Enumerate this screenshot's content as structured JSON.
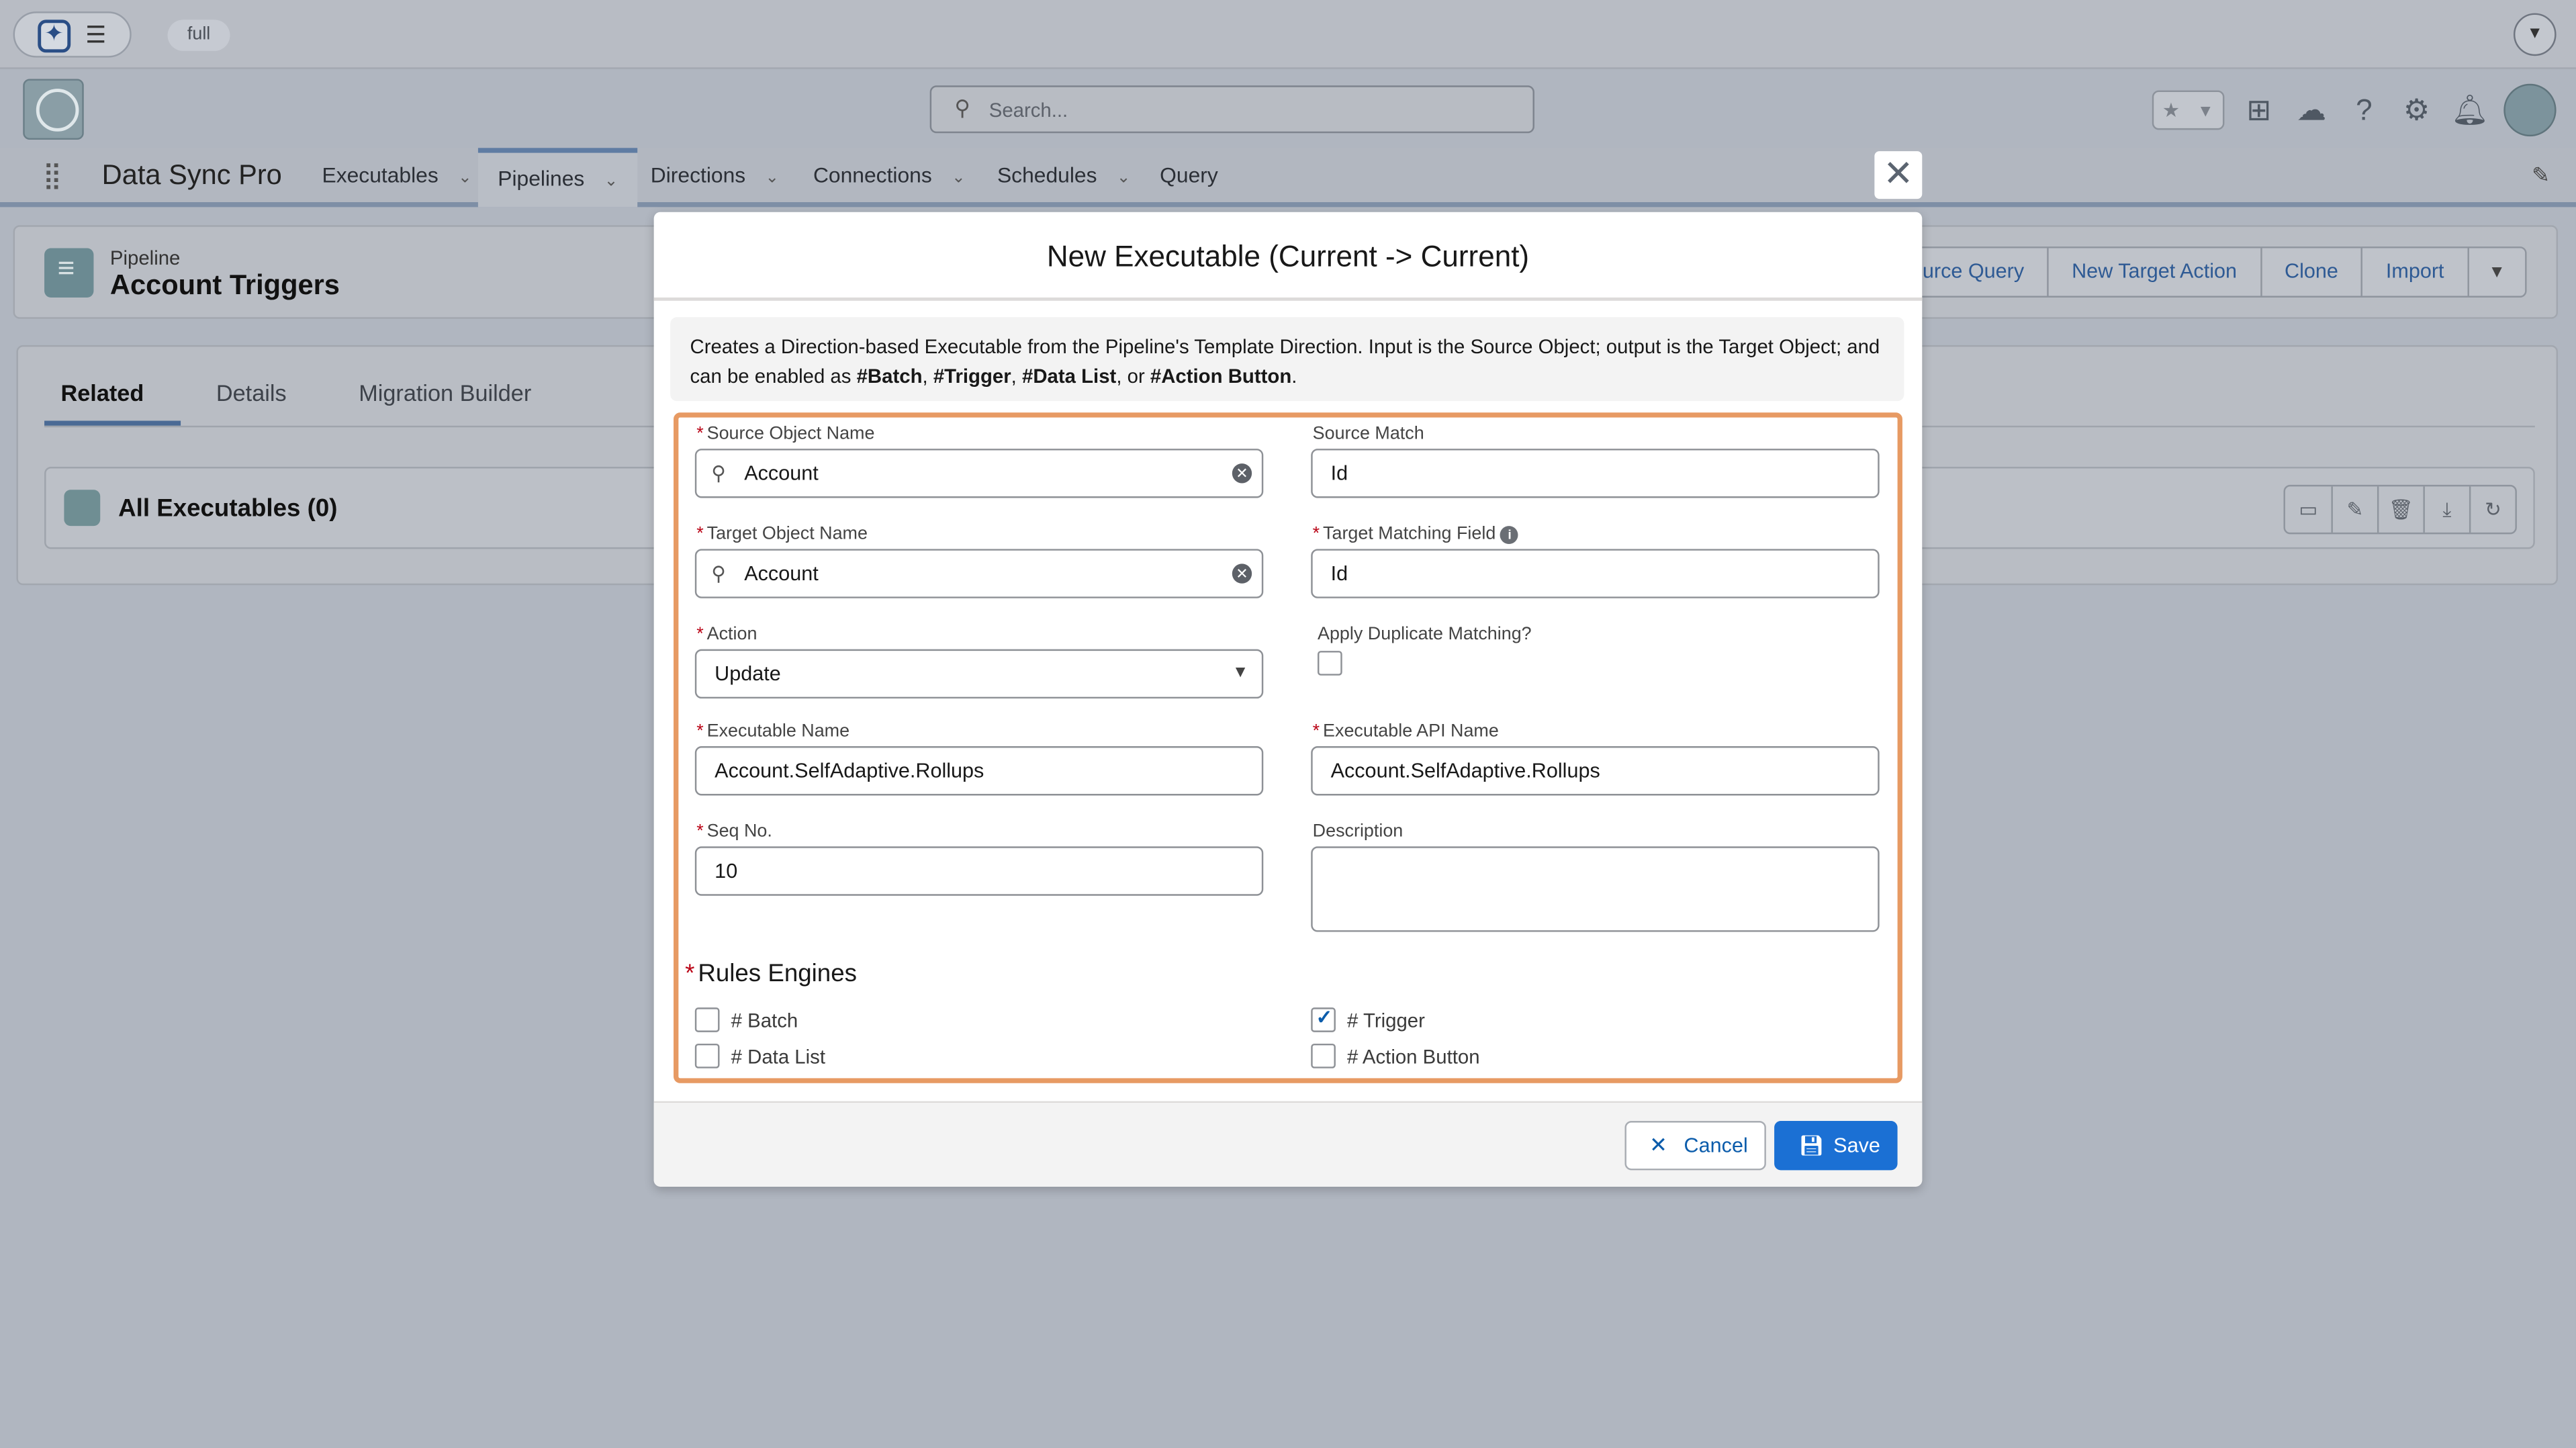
{
  "topbar": {
    "env_badge": "full",
    "agent_icon": "sparkle-icon",
    "menu_icon": "hamburger-icon",
    "corner_icon": "chevron-down-icon"
  },
  "header": {
    "search_placeholder": "Search...",
    "icons": [
      "star-icon",
      "chevron-down-icon",
      "add-icon",
      "cloud-icon",
      "help-icon",
      "gear-icon",
      "bell-icon",
      "avatar"
    ]
  },
  "nav": {
    "app_name": "Data Sync Pro",
    "tabs": [
      {
        "label": "Executables"
      },
      {
        "label": "Pipelines"
      },
      {
        "label": "Directions"
      },
      {
        "label": "Connections"
      },
      {
        "label": "Schedules"
      },
      {
        "label": "Query"
      }
    ]
  },
  "record": {
    "type": "Pipeline",
    "name": "Account Triggers",
    "actions": [
      "Source Query",
      "New Target Action",
      "Clone",
      "Import"
    ]
  },
  "tabs": {
    "items": [
      "Related",
      "Details",
      "Migration Builder"
    ],
    "active": "Related"
  },
  "related": {
    "title": "All Executables (0)"
  },
  "modal": {
    "title": "New Executable (Current -> Current)",
    "notice_pre": "Creates a Direction-based Executable from the Pipeline's Template Direction. Input is the Source Object; output is the Target Object; and can be enabled as ",
    "notice_batch": "#Batch",
    "notice_sep1": ", ",
    "notice_trigger": "#Trigger",
    "notice_sep2": ", ",
    "notice_datalist": "#Data List",
    "notice_sep3": ", or ",
    "notice_action": "#Action Button",
    "notice_end": ".",
    "fields": {
      "source_object_label": "Source Object Name",
      "source_object_value": "Account",
      "source_match_label": "Source Match",
      "source_match_value": "Id",
      "target_object_label": "Target Object Name",
      "target_object_value": "Account",
      "target_matching_label": "Target Matching Field",
      "target_matching_value": "Id",
      "action_label": "Action",
      "action_value": "Update",
      "duplicate_label": "Apply Duplicate Matching?",
      "duplicate_checked": false,
      "exec_name_label": "Executable Name",
      "exec_name_value": "Account.SelfAdaptive.Rollups",
      "exec_api_label": "Executable API Name",
      "exec_api_value": "Account.SelfAdaptive.Rollups",
      "seq_label": "Seq No.",
      "seq_value": "10",
      "description_label": "Description",
      "description_value": ""
    },
    "rules": {
      "title": "Rules Engines",
      "batch": "# Batch",
      "batch_checked": false,
      "data_list": "# Data List",
      "data_list_checked": false,
      "trigger": "# Trigger",
      "trigger_checked": true,
      "action_button": "# Action Button",
      "action_button_checked": false
    },
    "cancel": "Cancel",
    "save": "Save"
  },
  "colors": {
    "brand_button": "#1b70d4",
    "link": "#0b5cab",
    "required": "#ba0517",
    "highlight_border": "#e79a63"
  }
}
